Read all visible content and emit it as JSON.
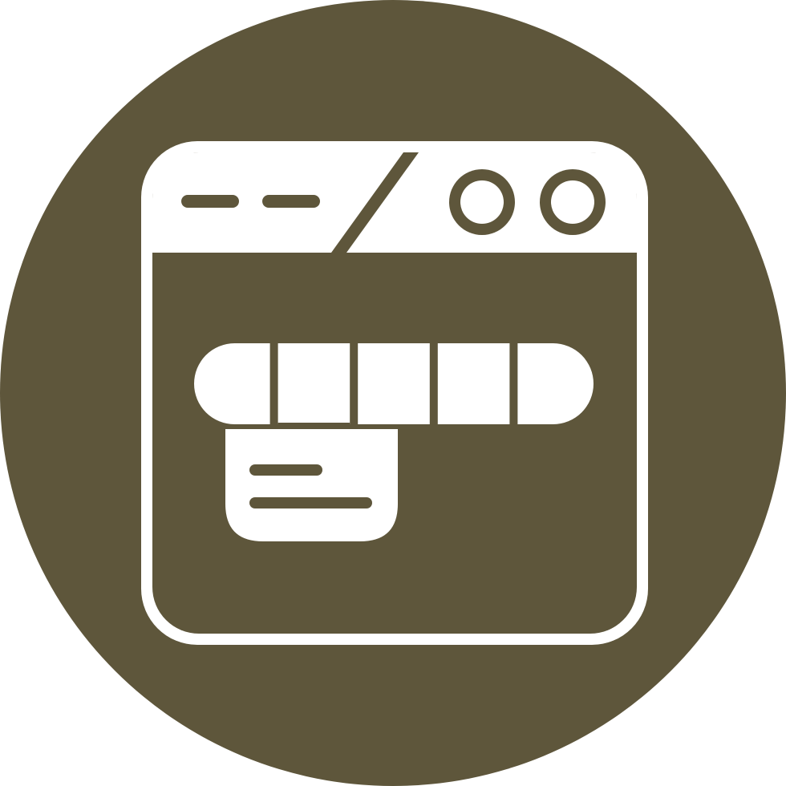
{
  "icon": {
    "name": "browser-window-progress-stepper-icon",
    "colors": {
      "background": "#ffffff",
      "badge": "#5e563b",
      "glyph": "#ffffff"
    },
    "progress": {
      "total_segments": 5,
      "active_segment": 2
    }
  }
}
